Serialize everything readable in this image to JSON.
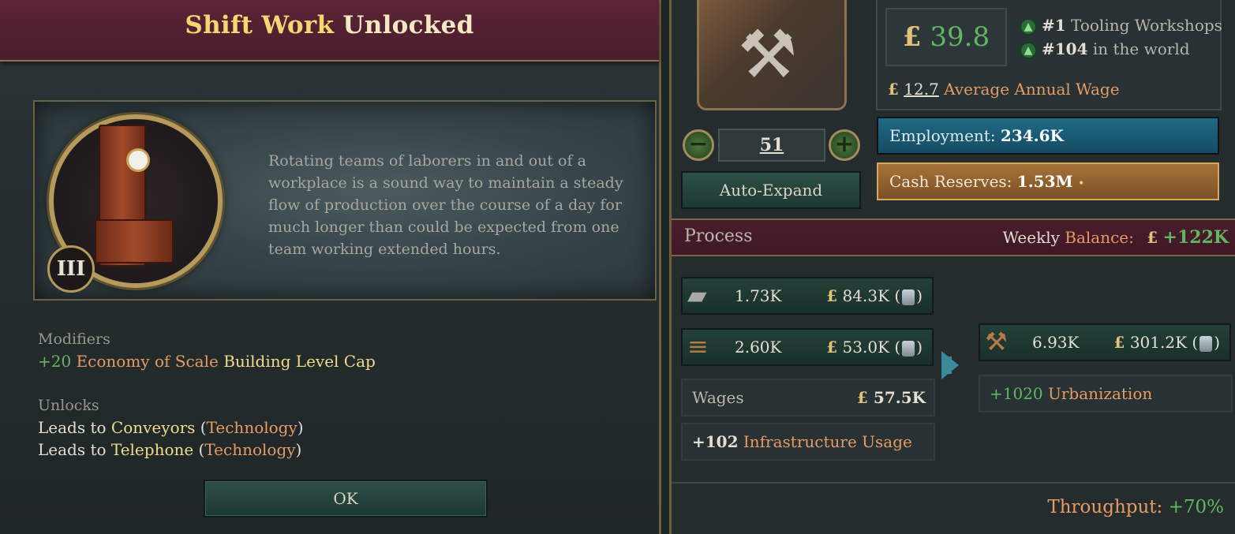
{
  "dialog": {
    "title_highlight": "Shift Work",
    "title_rest": "Unlocked",
    "tier": "III",
    "description": "Rotating teams of laborers in and out of a workplace is a sound way to maintain a steady flow of production over the course of a day for much longer than could be expected from one team working extended hours.",
    "modifiers_label": "Modifiers",
    "modifier_value": "+20",
    "modifier_name": "Economy of Scale",
    "modifier_target": "Building Level Cap",
    "unlocks_label": "Unlocks",
    "unlocks": [
      {
        "prefix": "Leads to",
        "name": "Conveyors",
        "type": "Technology"
      },
      {
        "prefix": "Leads to",
        "name": "Telephone",
        "type": "Technology"
      }
    ],
    "ok_label": "OK"
  },
  "building": {
    "icon": "hammer-and-pliers-icon",
    "wage_pound": "£",
    "wage_value": "39.8",
    "rank_1_num": "#1",
    "rank_1_label": "Tooling Workshops",
    "rank_2_num": "#104",
    "rank_2_label": "in the world",
    "avg_wage_pound": "£",
    "avg_wage_value": "12.7",
    "avg_wage_label": "Average Annual Wage",
    "level": "51",
    "decrease_label": "−",
    "increase_label": "+",
    "auto_expand_label": "Auto-Expand",
    "employment_label": "Employment:",
    "employment_value": "234.6K",
    "cash_label": "Cash Reserves:",
    "cash_value": "1.53M"
  },
  "process": {
    "title": "Process",
    "weekly_label": "Weekly",
    "balance_label": "Balance:",
    "balance_pound": "£",
    "balance_value": "+122K",
    "inputs": [
      {
        "icon": "iron-ingot-icon",
        "qty": "1.73K",
        "price_pound": "£",
        "price": "84.3K"
      },
      {
        "icon": "wood-logs-icon",
        "qty": "2.60K",
        "price_pound": "£",
        "price": "53.0K"
      }
    ],
    "wages_label": "Wages",
    "wages_pound": "£",
    "wages_value": "57.5K",
    "infra_value": "+102",
    "infra_label": "Infrastructure Usage",
    "output": {
      "icon": "tools-icon",
      "qty": "6.93K",
      "price_pound": "£",
      "price": "301.2K"
    },
    "urban_value": "+1020",
    "urban_label": "Urbanization",
    "throughput_label": "Throughput:",
    "throughput_value": "+70%"
  }
}
